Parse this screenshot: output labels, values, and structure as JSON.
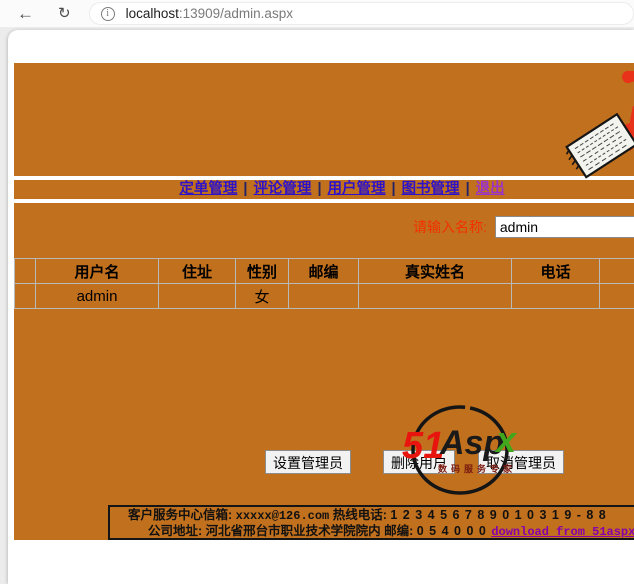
{
  "browser": {
    "back_glyph": "←",
    "reload_glyph": "↻",
    "info_glyph": "i",
    "url_host": "localhost",
    "url_rest": ":13909/admin.aspx"
  },
  "nav": {
    "sep": "|",
    "links": [
      {
        "label": "定单管理"
      },
      {
        "label": "评论管理"
      },
      {
        "label": "用户管理"
      },
      {
        "label": "图书管理"
      },
      {
        "label": "退出"
      }
    ]
  },
  "search": {
    "label": "请输入名称:",
    "value": "admin"
  },
  "table": {
    "headers": [
      "",
      "用户名",
      "住址",
      "性别",
      "邮编",
      "真实姓名",
      "电话",
      ""
    ],
    "rows": [
      [
        "",
        "admin",
        "",
        "女",
        "",
        "",
        "",
        ""
      ]
    ]
  },
  "buttons": {
    "set_admin": "设置管理员",
    "delete_user": "删除用户",
    "cancel_admin": "取消管理员"
  },
  "logo": {
    "n51": "51",
    "asp": "Asp",
    "x": "x",
    "tagline": "数码服务专家"
  },
  "footer": {
    "line1_left": "客户服务中心信箱: ",
    "email": "xxxxx@126.com",
    "line1_mid": "    热线电话: ",
    "phone": "1 2 3 4 5 6 7 8 9 0 1  0 3 1 9 - 8 8",
    "line2_left": "公司地址: 河北省邢台市职业技术学院院内 邮编: ",
    "zip": "0 5 4 0 0 0 ",
    "link": "download from 51aspx"
  },
  "colors": {
    "orange": "#c1701e",
    "link_blue": "#2e12c9",
    "link_visited": "#9933cc",
    "label_red": "#f33000",
    "logo_red": "#e8150f",
    "logo_green": "#41a81e",
    "table_border": "#b9b9b9"
  }
}
